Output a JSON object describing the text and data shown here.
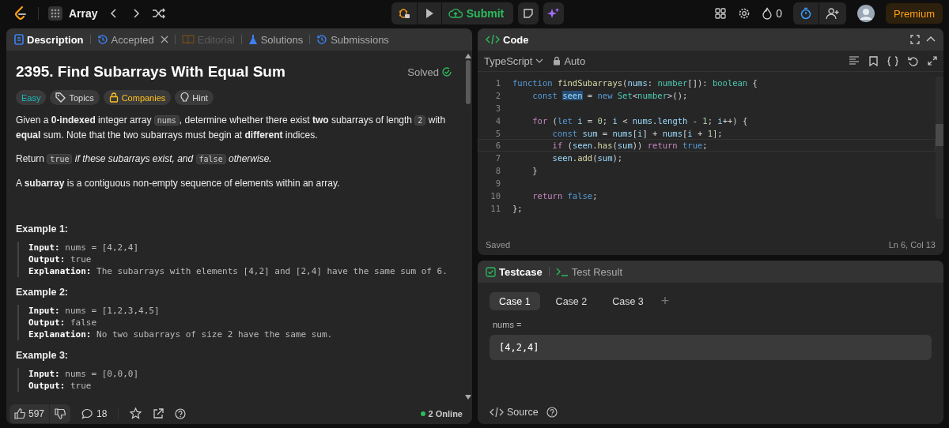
{
  "topbar": {
    "problem_list": "Array",
    "submit": "Submit",
    "streak": "0",
    "premium": "Premium"
  },
  "description_tabs": [
    {
      "label": "Description",
      "selected": true,
      "disabled": false,
      "closable": false,
      "kind": "doc"
    },
    {
      "label": "Accepted",
      "selected": false,
      "disabled": false,
      "closable": true,
      "kind": "history"
    },
    {
      "label": "Editorial",
      "selected": false,
      "disabled": true,
      "closable": false,
      "kind": "book"
    },
    {
      "label": "Solutions",
      "selected": false,
      "disabled": false,
      "closable": false,
      "kind": "flask"
    },
    {
      "label": "Submissions",
      "selected": false,
      "disabled": false,
      "closable": false,
      "kind": "history"
    }
  ],
  "problem": {
    "title": "2395. Find Subarrays With Equal Sum",
    "status": "Solved",
    "tags": [
      {
        "label": "Easy",
        "kind": "difficulty"
      },
      {
        "label": "Topics",
        "kind": "topics"
      },
      {
        "label": "Companies",
        "kind": "companies"
      },
      {
        "label": "Hint",
        "kind": "hint"
      }
    ],
    "paragraphs": [
      [
        {
          "kind": "text",
          "text": "Given a **0-indexed** integer array "
        },
        {
          "kind": "code",
          "text": "nums"
        },
        {
          "kind": "text",
          "text": ", determine whether there exist **two** subarrays of length "
        },
        {
          "kind": "code",
          "text": "2"
        },
        {
          "kind": "text",
          "text": " with **equal** sum. Note that the two subarrays must begin at **different** indices."
        }
      ],
      [
        {
          "kind": "text",
          "text": "Return "
        },
        {
          "kind": "code",
          "text": "true"
        },
        {
          "kind": "text",
          "text": " *if these subarrays exist, and* "
        },
        {
          "kind": "code",
          "text": "false"
        },
        {
          "kind": "text",
          "text": " *otherwise.*"
        }
      ],
      [
        {
          "kind": "text",
          "text": "A **subarray** is a contiguous non-empty sequence of elements within an array."
        }
      ]
    ],
    "examples": [
      {
        "title": "Example 1:",
        "lines": [
          "**Input:** nums = [4,2,4]",
          "**Output:** true",
          "**Explanation:** The subarrays with elements [4,2] and [2,4] have the same sum of 6."
        ]
      },
      {
        "title": "Example 2:",
        "lines": [
          "**Input:** nums = [1,2,3,4,5]",
          "**Output:** false",
          "**Explanation:** No two subarrays of size 2 have the same sum."
        ]
      },
      {
        "title": "Example 3:",
        "lines": [
          "**Input:** nums = [0,0,0]",
          "**Output:** true"
        ]
      }
    ]
  },
  "footer": {
    "likes": "597",
    "comments": "18",
    "online": "2 Online"
  },
  "code_panel": {
    "title": "Code",
    "language": "TypeScript",
    "mode": "Auto",
    "status": "Saved",
    "cursor": "Ln 6, Col 13",
    "lines": [
      {
        "number": "1",
        "current": false,
        "tokens": [
          {
            "kind": "kw",
            "text": "function "
          },
          {
            "kind": "fn",
            "text": "findSubarrays"
          },
          {
            "kind": "plain",
            "text": "("
          },
          {
            "kind": "var",
            "text": "nums"
          },
          {
            "kind": "plain",
            "text": ": "
          },
          {
            "kind": "type",
            "text": "number"
          },
          {
            "kind": "plain",
            "text": "[]): "
          },
          {
            "kind": "type",
            "text": "boolean"
          },
          {
            "kind": "plain",
            "text": " {"
          }
        ]
      },
      {
        "number": "2",
        "current": false,
        "tokens": [
          {
            "kind": "kw",
            "text": "    const "
          },
          {
            "kind": "match",
            "text": "seen"
          },
          {
            "kind": "plain",
            "text": " = "
          },
          {
            "kind": "kw",
            "text": "new "
          },
          {
            "kind": "type",
            "text": "Set"
          },
          {
            "kind": "plain",
            "text": "<"
          },
          {
            "kind": "type",
            "text": "number"
          },
          {
            "kind": "plain",
            "text": ">();"
          }
        ]
      },
      {
        "number": "3",
        "current": false
      },
      {
        "number": "4",
        "current": false,
        "tokens": [
          {
            "kind": "ctrl",
            "text": "    for"
          },
          {
            "kind": "plain",
            "text": " ("
          },
          {
            "kind": "kw",
            "text": "let "
          },
          {
            "kind": "var",
            "text": "i"
          },
          {
            "kind": "plain",
            "text": " = "
          },
          {
            "kind": "num",
            "text": "0"
          },
          {
            "kind": "plain",
            "text": "; "
          },
          {
            "kind": "var",
            "text": "i"
          },
          {
            "kind": "plain",
            "text": " < "
          },
          {
            "kind": "var",
            "text": "nums"
          },
          {
            "kind": "plain",
            "text": "."
          },
          {
            "kind": "var",
            "text": "length"
          },
          {
            "kind": "plain",
            "text": " - "
          },
          {
            "kind": "num",
            "text": "1"
          },
          {
            "kind": "plain",
            "text": "; "
          },
          {
            "kind": "var",
            "text": "i"
          },
          {
            "kind": "plain",
            "text": "++) {"
          }
        ]
      },
      {
        "number": "5",
        "current": false,
        "tokens": [
          {
            "kind": "kw",
            "text": "        const "
          },
          {
            "kind": "var",
            "text": "sum"
          },
          {
            "kind": "plain",
            "text": " = "
          },
          {
            "kind": "var",
            "text": "nums"
          },
          {
            "kind": "plain",
            "text": "["
          },
          {
            "kind": "var",
            "text": "i"
          },
          {
            "kind": "plain",
            "text": "] + "
          },
          {
            "kind": "var",
            "text": "nums"
          },
          {
            "kind": "plain",
            "text": "["
          },
          {
            "kind": "var",
            "text": "i"
          },
          {
            "kind": "plain",
            "text": " + "
          },
          {
            "kind": "num",
            "text": "1"
          },
          {
            "kind": "plain",
            "text": "];"
          }
        ]
      },
      {
        "number": "6",
        "current": true,
        "tokens": [
          {
            "kind": "ctrl",
            "text": "        if"
          },
          {
            "kind": "plain",
            "text": " ("
          },
          {
            "kind": "var",
            "text": "seen"
          },
          {
            "kind": "plain",
            "text": "."
          },
          {
            "kind": "fn",
            "text": "has"
          },
          {
            "kind": "plain",
            "text": "("
          },
          {
            "kind": "var",
            "text": "sum"
          },
          {
            "kind": "plain",
            "text": ")) "
          },
          {
            "kind": "ctrl",
            "text": "return "
          },
          {
            "kind": "kw",
            "text": "true"
          },
          {
            "kind": "plain",
            "text": ";"
          }
        ]
      },
      {
        "number": "7",
        "current": false,
        "tokens": [
          {
            "kind": "var",
            "text": "        seen"
          },
          {
            "kind": "plain",
            "text": "."
          },
          {
            "kind": "fn",
            "text": "add"
          },
          {
            "kind": "plain",
            "text": "("
          },
          {
            "kind": "var",
            "text": "sum"
          },
          {
            "kind": "plain",
            "text": ");"
          }
        ]
      },
      {
        "number": "8",
        "current": false,
        "tokens": [
          {
            "kind": "plain",
            "text": "    }"
          }
        ]
      },
      {
        "number": "9",
        "current": false
      },
      {
        "number": "10",
        "current": false,
        "tokens": [
          {
            "kind": "ctrl",
            "text": "    return "
          },
          {
            "kind": "kw",
            "text": "false"
          },
          {
            "kind": "plain",
            "text": ";"
          }
        ]
      },
      {
        "number": "11",
        "current": false,
        "tokens": [
          {
            "kind": "plain",
            "text": "};"
          }
        ]
      }
    ]
  },
  "test_tabs": [
    {
      "label": "Testcase",
      "selected": true
    },
    {
      "label": "Test Result",
      "selected": false
    }
  ],
  "cases": [
    {
      "label": "Case 1",
      "selected": true
    },
    {
      "label": "Case 2",
      "selected": false
    },
    {
      "label": "Case 3",
      "selected": false
    }
  ],
  "add_case": "+",
  "input": {
    "label": "nums =",
    "value": "[4,2,4]"
  },
  "source": "Source"
}
